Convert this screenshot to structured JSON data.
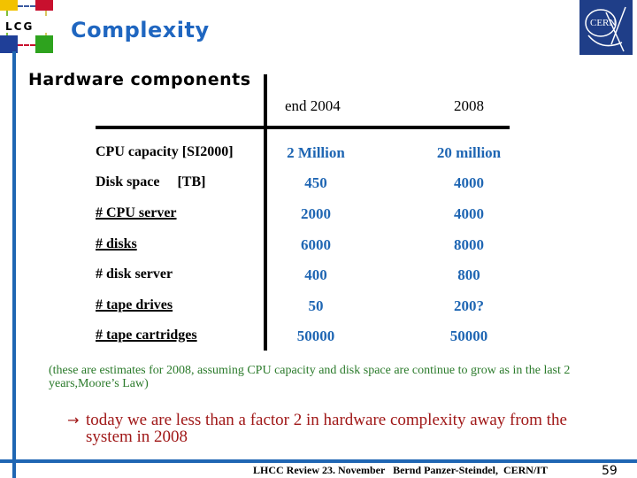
{
  "header": {
    "logo_left_text": "LCG",
    "title": "Complexity",
    "logo_right_text": "CERN"
  },
  "subtitle": "Hardware components",
  "table": {
    "columns": [
      "end 2004",
      "2008"
    ],
    "rows": [
      {
        "label": "CPU capacity [SI2000]",
        "underlined": false,
        "values": [
          "2 Million",
          "20 million"
        ]
      },
      {
        "label": "Disk space     [TB]",
        "underlined": false,
        "values": [
          "450",
          "4000"
        ]
      },
      {
        "label": "# CPU server",
        "underlined": true,
        "values": [
          "2000",
          "4000"
        ]
      },
      {
        "label": "# disks",
        "underlined": true,
        "values": [
          "6000",
          "8000"
        ]
      },
      {
        "label": "# disk server",
        "underlined": false,
        "values": [
          "400",
          "800"
        ]
      },
      {
        "label": "# tape drives",
        "underlined": true,
        "values": [
          "50",
          "200?"
        ]
      },
      {
        "label": "# tape cartridges",
        "underlined": true,
        "values": [
          "50000",
          "50000"
        ]
      }
    ]
  },
  "note": "(these are estimates for 2008, assuming CPU capacity and disk space are continue to grow as in the last 2 years,Moore’s Law)",
  "conclusion": {
    "arrow": "→",
    "text": "today we are less than a factor 2 in hardware complexity away from the system in 2008"
  },
  "footer": {
    "text": "LHCC Review 23. November   Bernd Panzer-Steindel,  CERN/IT",
    "page_number": "59"
  },
  "colors": {
    "title": "#1f66c0",
    "values": "#1f66b3",
    "note": "#2a7a2a",
    "conclusion": "#a01818",
    "frame": "#1f66b3"
  }
}
